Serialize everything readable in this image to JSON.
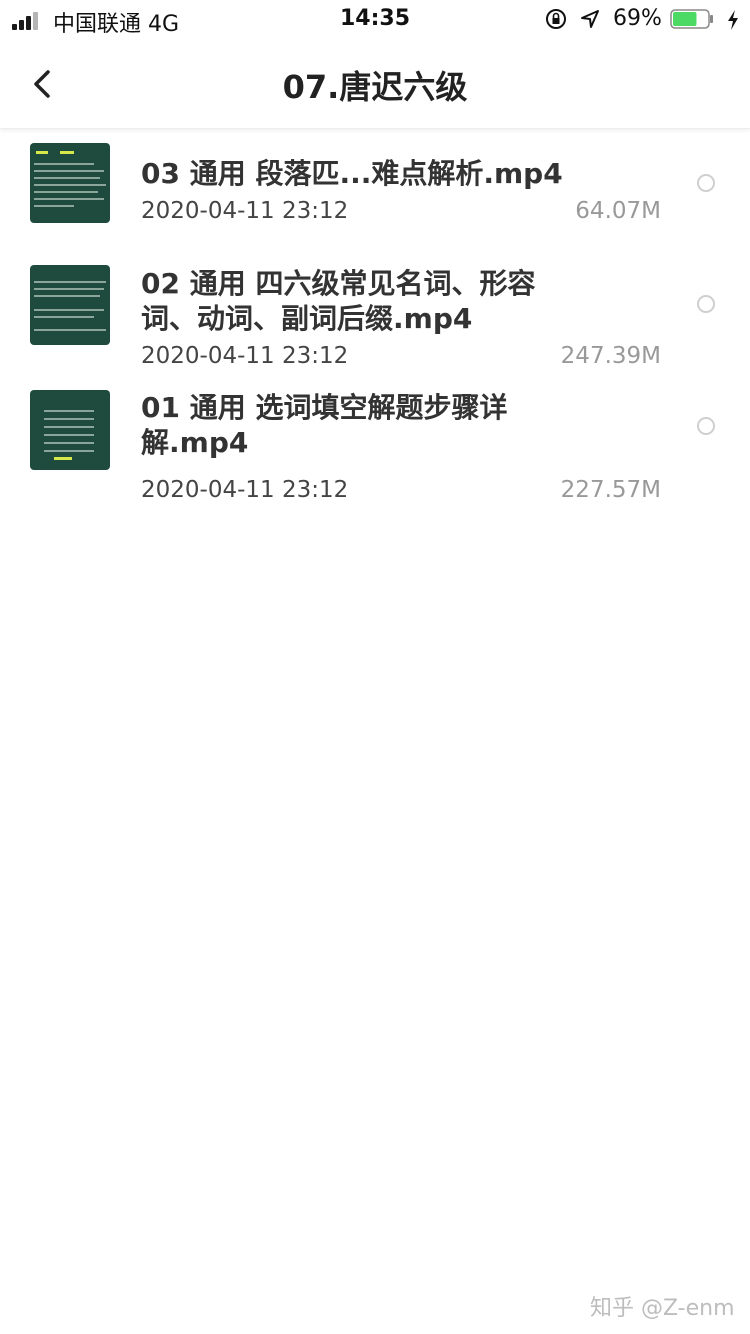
{
  "status_bar": {
    "carrier": "中国联通   4G",
    "time": "14:35",
    "battery_percent": "69%",
    "battery_level": 0.69,
    "battery_color": "#4cd964"
  },
  "nav": {
    "back_icon": "chevron-left-icon",
    "title": "07.唐迟六级"
  },
  "files": [
    {
      "name": "03 通用 段落匹...难点解析.mp4",
      "date": "2020-04-11 23:12",
      "size": "64.07M",
      "selected": false
    },
    {
      "name": "02 通用 四六级常见名词、形容词、动词、副词后缀.mp4",
      "date": "2020-04-11 23:12",
      "size": "247.39M",
      "selected": false
    },
    {
      "name": "01 通用 选词填空解题步骤详解.mp4",
      "date": "2020-04-11 23:12",
      "size": "227.57M",
      "selected": false
    }
  ],
  "watermark": "知乎 @Z-enm",
  "colors": {
    "thumbnail_bg": "#1e4b3e",
    "text_primary": "#333333",
    "text_secondary": "#999999"
  }
}
